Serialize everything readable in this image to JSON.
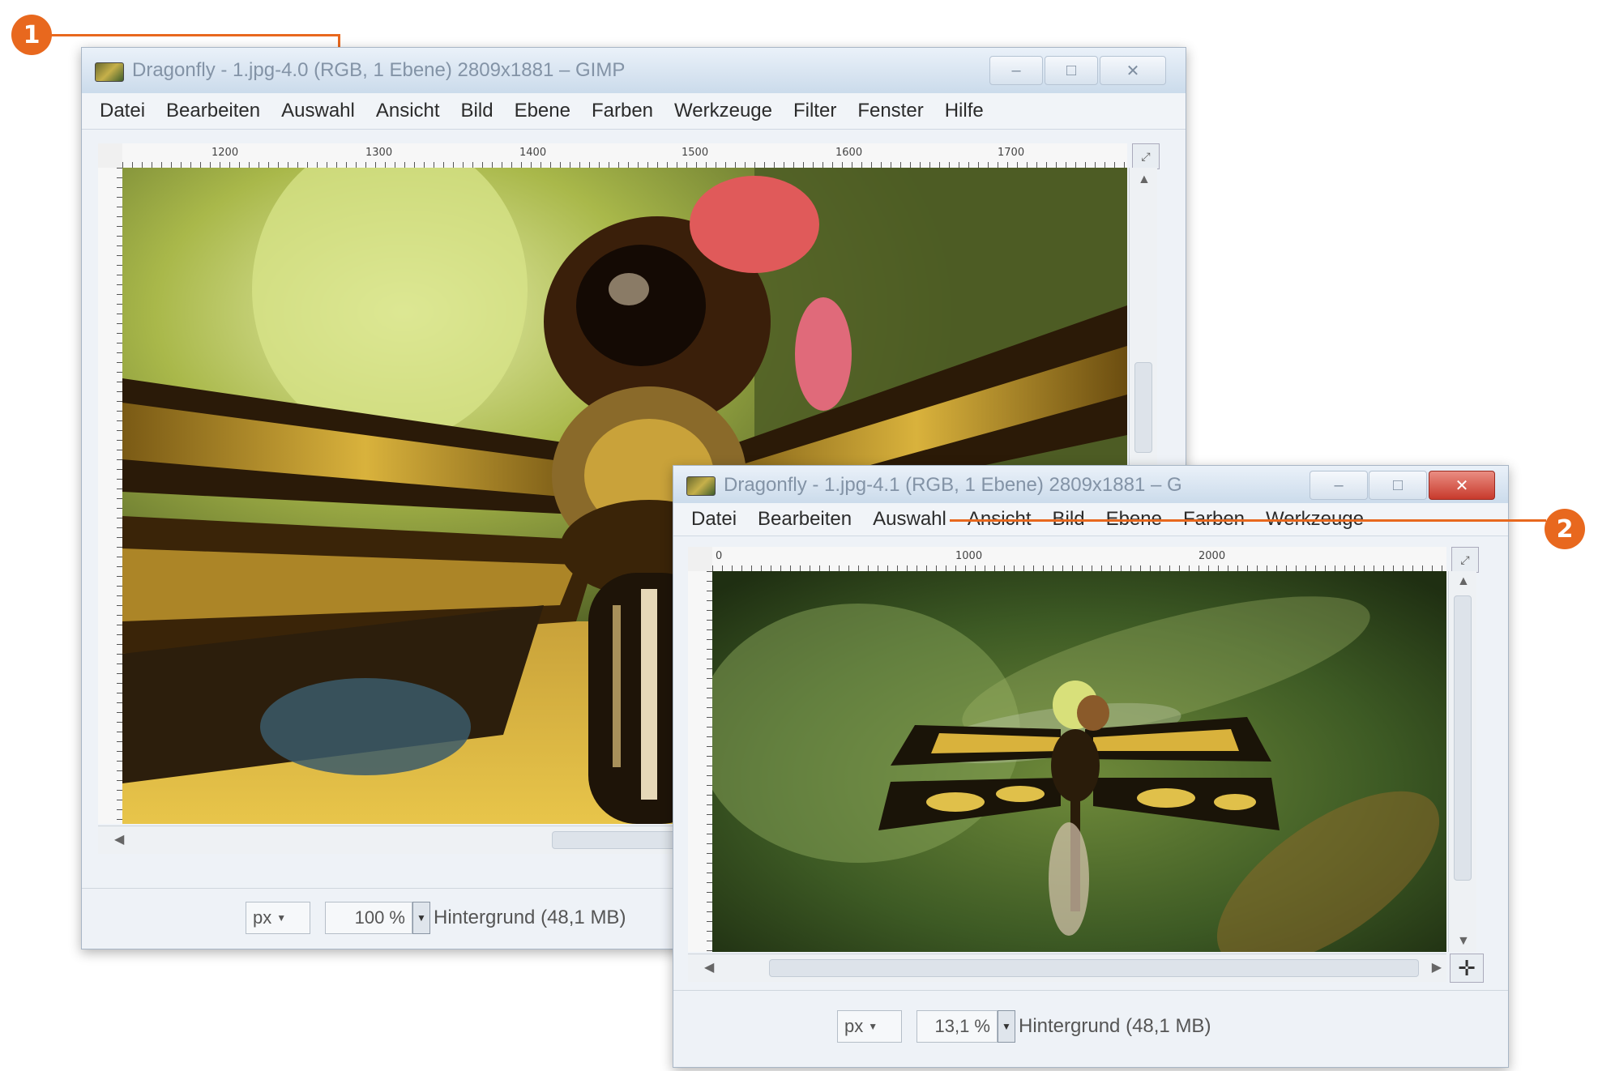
{
  "callouts": [
    "1",
    "2"
  ],
  "window_back": {
    "title": "Dragonfly - 1.jpg-4.0 (RGB, 1 Ebene) 2809x1881 – GIMP",
    "menu": [
      "Datei",
      "Bearbeiten",
      "Auswahl",
      "Ansicht",
      "Bild",
      "Ebene",
      "Farben",
      "Werkzeuge",
      "Filter",
      "Fenster",
      "Hilfe"
    ],
    "ruler_ticks": [
      "1200",
      "1300",
      "1400",
      "1500",
      "1600",
      "1700"
    ],
    "unit": "px",
    "zoom": "100 %",
    "layer_info": "Hintergrund (48,1 MB)"
  },
  "window_front": {
    "title": "Dragonfly - 1.jpg-4.1 (RGB, 1 Ebene) 2809x1881 – G",
    "menu": [
      "Datei",
      "Bearbeiten",
      "Auswahl",
      "Ansicht",
      "Bild",
      "Ebene",
      "Farben",
      "Werkzeuge"
    ],
    "ruler_ticks": [
      "0",
      "1000",
      "2000"
    ],
    "unit": "px",
    "zoom": "13,1 %",
    "layer_info": "Hintergrund (48,1 MB)"
  },
  "icons": {
    "minimize": "minimize-icon",
    "maximize": "maximize-icon",
    "close": "close-icon",
    "navigate": "navigate-crosshair-icon"
  },
  "colors": {
    "callout": "#e8681e",
    "close_button": "#c83a2c"
  }
}
